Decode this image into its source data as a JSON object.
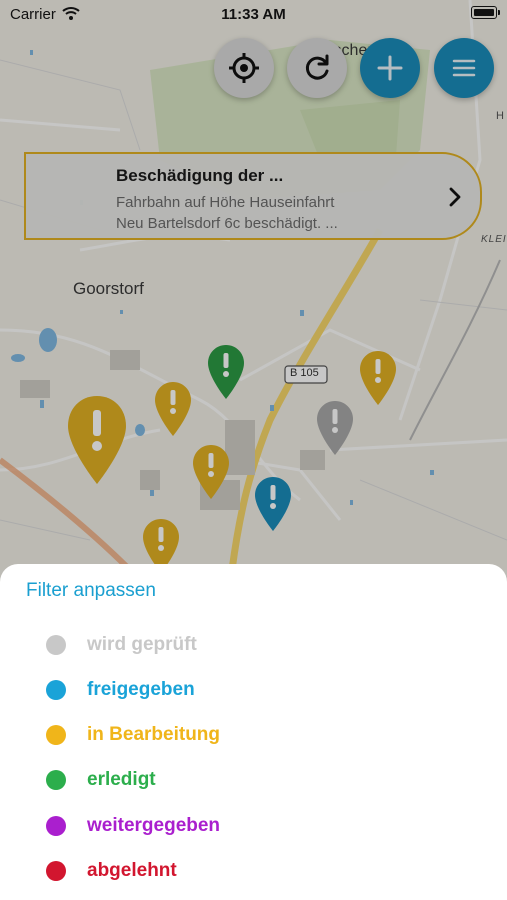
{
  "status_bar": {
    "carrier": "Carrier",
    "time": "11:33 AM"
  },
  "map": {
    "labels": {
      "place": "Goorstorf",
      "road": "B 105",
      "top_place": "ischendorf",
      "edge_h": "H",
      "edge_klei": "KLEI"
    }
  },
  "toolbar": {
    "locate_icon": "crosshair-icon",
    "refresh_icon": "refresh-icon",
    "add_icon": "plus-icon",
    "menu_icon": "hamburger-icon"
  },
  "report_card": {
    "title": "Beschädigung der ...",
    "description_line1": "Fahrbahn auf Höhe Hauseinfahrt",
    "description_line2": "Neu Bartelsdorf 6c beschädigt. ...",
    "border_color": "#e0b023"
  },
  "filter_sheet": {
    "title": "Filter anpassen",
    "items": [
      {
        "label": "wird geprüft",
        "color": "#c8c8c8"
      },
      {
        "label": "freigegeben",
        "color": "#1aa3d8"
      },
      {
        "label": "in Bearbeitung",
        "color": "#f0b51a"
      },
      {
        "label": "erledigt",
        "color": "#2cae4c"
      },
      {
        "label": "weitergegeben",
        "color": "#aa1fce"
      },
      {
        "label": "abgelehnt",
        "color": "#d2162f"
      }
    ]
  },
  "colors": {
    "accent": "#1a8cba",
    "marker_yellow": "#e0b023",
    "marker_green": "#2c9a44",
    "marker_blue": "#1a8cba",
    "marker_gray": "#a8a8a8"
  }
}
